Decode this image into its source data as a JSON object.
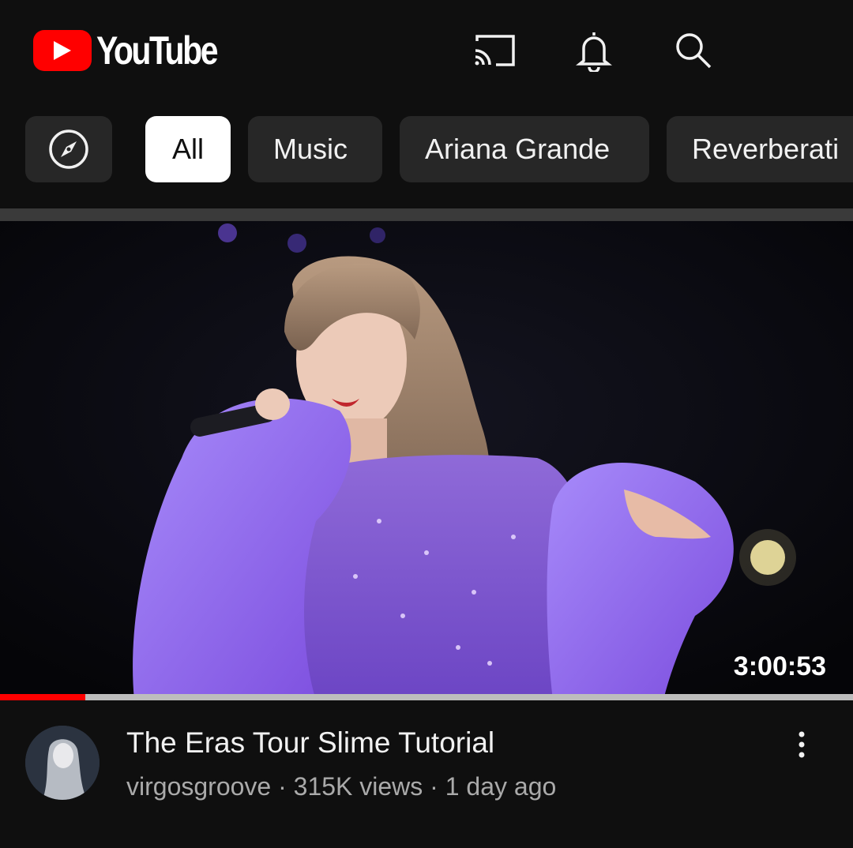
{
  "header": {
    "logo_text": "YouTube",
    "icons": [
      "cast-icon",
      "bell-icon",
      "search-icon"
    ]
  },
  "chips": {
    "explore_icon": "compass-icon",
    "items": [
      {
        "label": "All",
        "active": true
      },
      {
        "label": "Music",
        "active": false
      },
      {
        "label": "Ariana Grande",
        "active": false
      },
      {
        "label": "Reverberati",
        "active": false
      }
    ]
  },
  "video": {
    "duration": "3:00:53",
    "progress_fraction": 0.1,
    "title": "The Eras Tour Slime Tutorial",
    "meta": "virgosgroove · 315K views · 1 day ago"
  },
  "colors": {
    "brand_red": "#ff0000",
    "background": "#0f0f0f",
    "chip_bg": "#272727",
    "active_chip_bg": "#ffffff",
    "meta_text": "#aaaaaa",
    "outfit_purple": "#8b5cf6"
  }
}
